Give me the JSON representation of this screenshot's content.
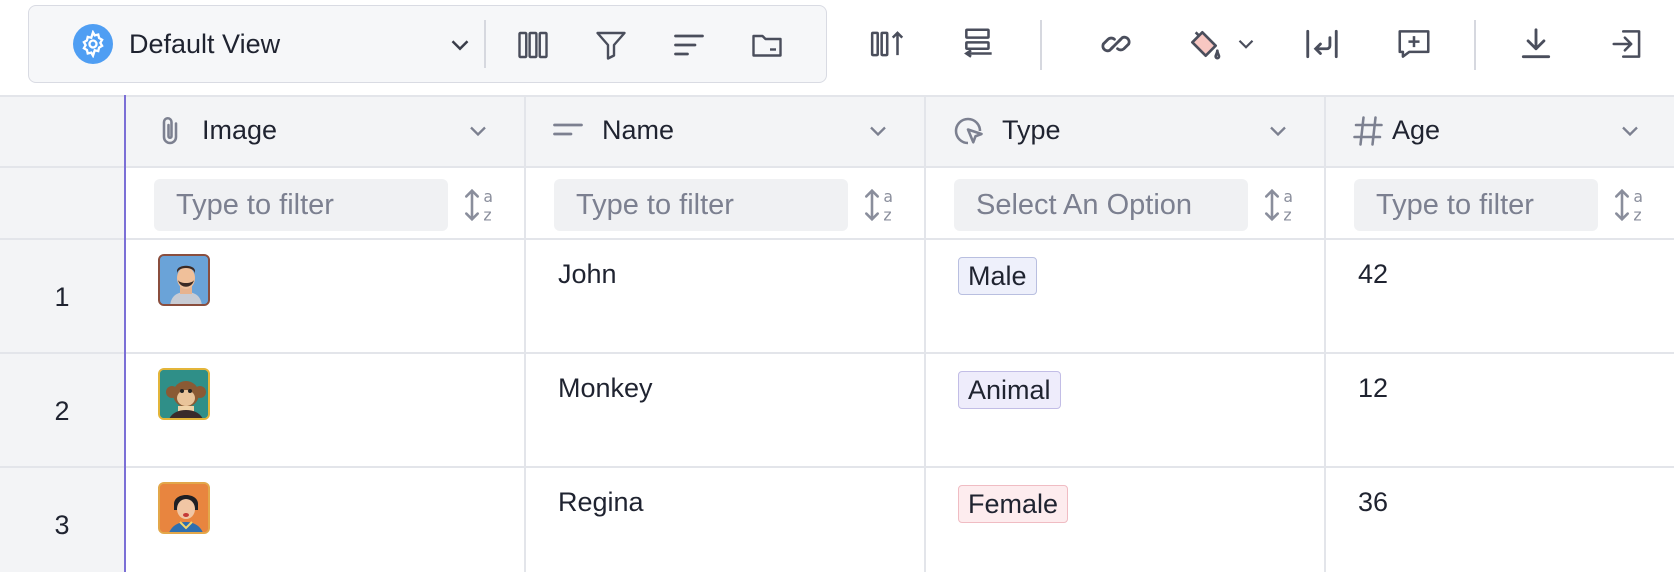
{
  "toolbar": {
    "view_name": "Default View",
    "icons": [
      "gear-icon",
      "chevron-down-icon",
      "columns-icon",
      "filter-icon",
      "sort-icon",
      "folder-icon",
      "column-add-icon",
      "row-height-icon",
      "link-icon",
      "paint-bucket-icon",
      "wrap-text-icon",
      "add-comment-icon",
      "download-icon",
      "import-icon"
    ]
  },
  "columns": [
    {
      "label": "Image",
      "icon": "paperclip-icon",
      "filter_placeholder": "Type to filter"
    },
    {
      "label": "Name",
      "icon": "text-lines-icon",
      "filter_placeholder": "Type to filter"
    },
    {
      "label": "Type",
      "icon": "select-cursor-icon",
      "filter_placeholder": "Select An Option"
    },
    {
      "label": "Age",
      "icon": "hash-icon",
      "filter_placeholder": "Type to filter"
    }
  ],
  "rows": [
    {
      "num": "1",
      "name": "John",
      "type": "Male",
      "age": "42",
      "type_color": "#eef0fb",
      "type_border": "#b9bfe0"
    },
    {
      "num": "2",
      "name": "Monkey",
      "type": "Animal",
      "age": "12",
      "type_color": "#eeecfb",
      "type_border": "#c2bde6"
    },
    {
      "num": "3",
      "name": "Regina",
      "type": "Female",
      "age": "36",
      "type_color": "#fdecee",
      "type_border": "#f0bcc3"
    }
  ],
  "colors": {
    "accent": "#4f9ef3",
    "row_border": "#7b6fd6"
  }
}
